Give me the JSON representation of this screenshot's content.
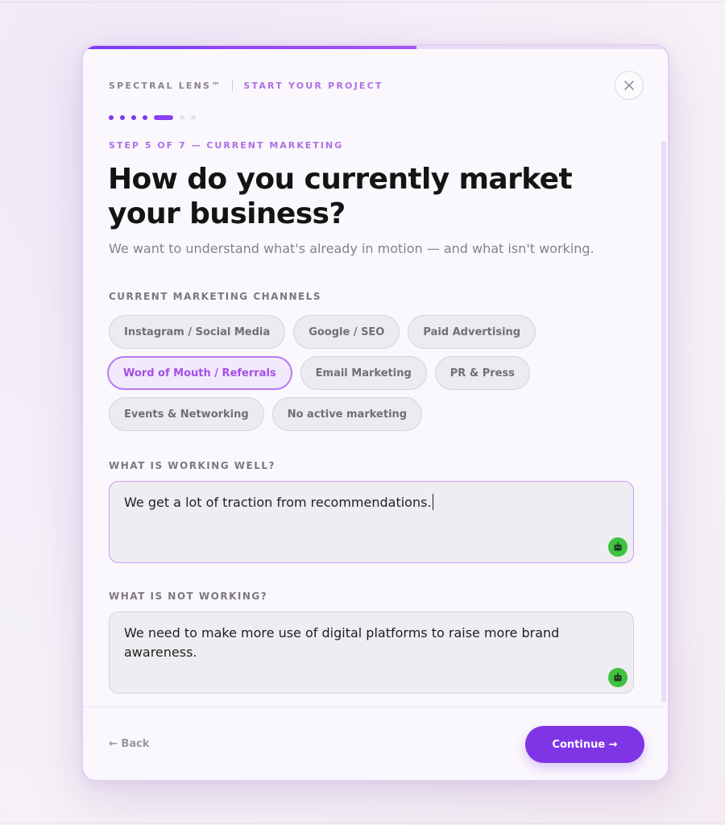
{
  "header": {
    "brand": "SPECTRAL LENS™",
    "section": "START YOUR PROJECT",
    "close_icon": "close-icon"
  },
  "progress": {
    "fraction": 0.57,
    "current_step": 5,
    "total_steps": 7
  },
  "step_label": "STEP 5 OF 7 — CURRENT MARKETING",
  "title": "How do you currently market your business?",
  "subtitle": "We want to understand what's already in motion — and what isn't working.",
  "channels": {
    "label": "CURRENT MARKETING CHANNELS",
    "options": [
      {
        "label": "Instagram / Social Media",
        "selected": false
      },
      {
        "label": "Google / SEO",
        "selected": false
      },
      {
        "label": "Paid Advertising",
        "selected": false
      },
      {
        "label": "Word of Mouth / Referrals",
        "selected": true
      },
      {
        "label": "Email Marketing",
        "selected": false
      },
      {
        "label": "PR & Press",
        "selected": false
      },
      {
        "label": "Events & Networking",
        "selected": false
      },
      {
        "label": "No active marketing",
        "selected": false
      }
    ]
  },
  "working_well": {
    "label": "WHAT IS WORKING WELL?",
    "value": "We get a lot of traction from recommendations."
  },
  "not_working": {
    "label": "WHAT IS NOT WORKING?",
    "value": "We need to make more use of digital platforms to raise more brand awareness."
  },
  "footer": {
    "back_label": "← Back",
    "continue_label": "Continue →"
  },
  "colors": {
    "accent": "#7f35e6",
    "accent_light": "#b06ee8",
    "assistant_badge": "#3fc23f"
  }
}
